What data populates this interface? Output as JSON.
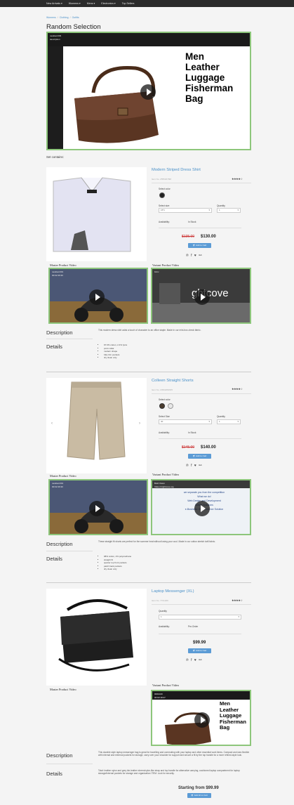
{
  "nav": {
    "items": [
      "New Arrivals ▾",
      "Womens ▾",
      "Mens ▾",
      "Electronics ▾",
      "Top Sellers"
    ]
  },
  "breadcrumb": {
    "items": [
      "Womens",
      "Clothing",
      "Outfits"
    ],
    "sep": "/"
  },
  "page_title": "Random Selection",
  "hero": {
    "tag1": "newitem003",
    "tag2": "description",
    "title_lines": [
      "Men",
      "Leather",
      "Luggage",
      "Fisherman",
      "Bag"
    ]
  },
  "set_contains": "Set contains:",
  "products": [
    {
      "name": "Modern Striped Dress Shirt",
      "sku": "Item No. 25552078M",
      "stars": "★★★★☆",
      "color_label": "Select color",
      "size_label": "Select size",
      "size_value": "15½",
      "qty_label": "Quantity",
      "qty_value": "1",
      "avail_label": "Availability:",
      "avail_value": "In Stock",
      "old_price": "$135.00",
      "price": "$130.00",
      "add_label": "Add to Cart",
      "share": "℗ f ♥ ⚯",
      "master_label": "Master Product Video",
      "variant_label": "Variant Product Video",
      "master_tag": "newitem001",
      "master_tag2": "00:02:46:30",
      "variant_tag": "brtcv",
      "variant_text": "ghtcove",
      "desc_title": "Description",
      "desc_text": "This modern dress shirt adds a touch of character to an office staple. Made in our mini-box-check fabric.",
      "details_title": "Details",
      "details": [
        "97.6% cotton, 2.4% lycra",
        "point collar",
        "modern shape",
        "fully trim pockets",
        "dry clean only"
      ]
    },
    {
      "name": "Colleen Straight Shorts",
      "sku": "Item No. 2450208W25",
      "stars": "★★★★☆",
      "color_label": "Select color",
      "size_label": "Select Size",
      "size_value": "40",
      "qty_label": "Quantity",
      "qty_value": "1",
      "avail_label": "Availability:",
      "avail_value": "In Stock",
      "old_price": "$145.00",
      "price": "$140.00",
      "add_label": "Add to Cart",
      "share": "℗ f ♥ ⚯",
      "master_label": "Master Product Video",
      "variant_label": "Variant Product Video",
      "master_tag": "newitem001",
      "master_tag2": "00:02:46:30",
      "variant_tag": "Bold Vision",
      "variant_tag2": "Video brightcove.org",
      "variant_lines": [
        "we separate you from the competition",
        "What we do!",
        "Web Design and Development",
        "Mobile Solutions",
        "e-Business / E-Commerce Solution"
      ],
      "desc_title": "Description",
      "desc_text": "These straight fit shorts are perfect for the summer heat without losing your cool. Made in our cotton stretch twill fabric.",
      "details_title": "Details",
      "details": [
        "98% cotton, 2% polyurethane",
        "straight fit",
        "quarter top front pockets",
        "patch back pockets",
        "dry clean only"
      ]
    },
    {
      "name": "Laptop Messenger (XL)",
      "sku": "Item No. 7721206",
      "stars": "★★★★☆",
      "qty_label": "Quantity",
      "qty_value": "1",
      "avail_label": "Availability:",
      "avail_value": "Pre-Order",
      "price": "$99.99",
      "add_label": "Add to Cart",
      "share": "℗ f ♥ ⚯",
      "master_label": "Master Product Video",
      "variant_label": "Variant Product Video",
      "variant_tag": "0001020",
      "variant_tag2": "00:02:18:27",
      "variant_title_lines": [
        "Men",
        "Leather",
        "Luggage",
        "Fisherman",
        "Bag"
      ],
      "desc_title": "Description",
      "desc_text": "This durable style laptop messenger bag is great for travelling and commuting with your laptop and other essential work items. Compact and size-flexible with internal and external pockets for storage, carry over your shoulder for support and secure a fit by the top handle for a more refined-style look.",
      "details_title": "Details",
      "details_text": "Total: leather nylon and grey bin-leather sheen/nylon-like strap and top handle for alternative carrying, cushioned laptop compartment for laptop storage/internal pockets for storage and organization ITEM: Lock for security."
    }
  ],
  "footer": {
    "starting": "Starting from $99.99",
    "add_all": "Add All to Cart"
  },
  "colors": {
    "accent": "#4a90c8",
    "border": "#8dc67b",
    "button": "#5b9bd5",
    "nav": "#2b2b2b"
  }
}
